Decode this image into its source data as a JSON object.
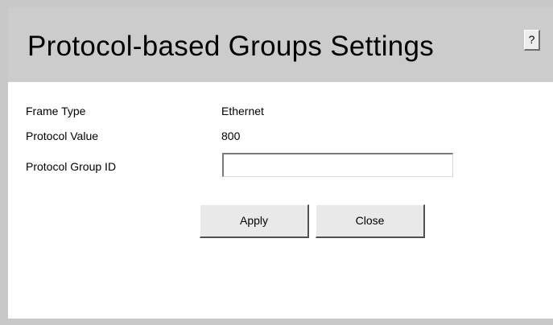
{
  "header": {
    "title": "Protocol-based Groups Settings",
    "help_label": "?"
  },
  "form": {
    "frame_type_label": "Frame Type",
    "frame_type_value": "Ethernet",
    "protocol_value_label": "Protocol Value",
    "protocol_value_value": "800",
    "protocol_group_id_label": "Protocol Group ID",
    "protocol_group_id_value": "",
    "protocol_group_id_placeholder": ""
  },
  "buttons": {
    "apply_label": "Apply",
    "close_label": "Close"
  },
  "colors": {
    "header_bg": "#cccccc",
    "frame_bg": "#c8c8c8",
    "button_bg": "#e9e9e9"
  }
}
